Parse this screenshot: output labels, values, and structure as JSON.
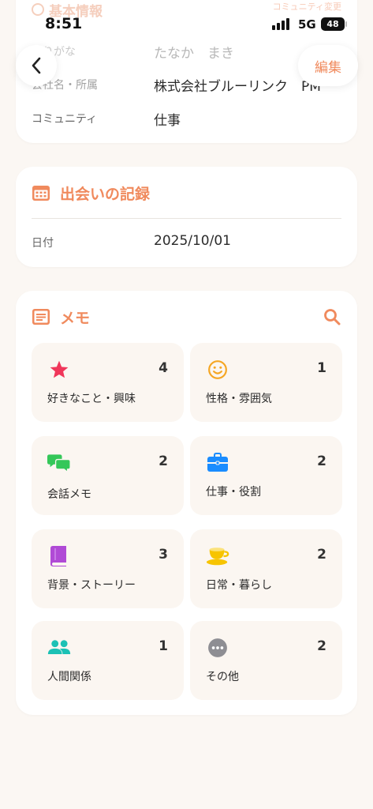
{
  "status_bar": {
    "time": "8:51",
    "network": "5G",
    "battery": "48"
  },
  "nav": {
    "edit_label": "編集"
  },
  "basic_info": {
    "title": "基本情報",
    "change_link": "コミュニティ変更",
    "rows": [
      {
        "label": "ふりがな",
        "value": "たなか　まき"
      },
      {
        "label": "会社名・所属",
        "value": "株式会社ブルーリンク　PM"
      },
      {
        "label": "コミュニティ",
        "value": "仕事"
      }
    ]
  },
  "encounter": {
    "title": "出会いの記録",
    "date_label": "日付",
    "date_value": "2025/10/01"
  },
  "memo": {
    "title": "メモ",
    "categories": [
      {
        "label": "好きなこと・興味",
        "count": "4",
        "icon": "star-icon",
        "color": "#f0365a"
      },
      {
        "label": "性格・雰囲気",
        "count": "1",
        "icon": "smile-icon",
        "color": "#f5a623"
      },
      {
        "label": "会話メモ",
        "count": "2",
        "icon": "chat-bubbles-icon",
        "color": "#34c759"
      },
      {
        "label": "仕事・役割",
        "count": "2",
        "icon": "briefcase-icon",
        "color": "#1a8cff"
      },
      {
        "label": "背景・ストーリー",
        "count": "3",
        "icon": "book-icon",
        "color": "#b04ad6"
      },
      {
        "label": "日常・暮らし",
        "count": "2",
        "icon": "coffee-cup-icon",
        "color": "#f7c400"
      },
      {
        "label": "人間関係",
        "count": "1",
        "icon": "people-icon",
        "color": "#1cc1b5"
      },
      {
        "label": "その他",
        "count": "2",
        "icon": "more-icon",
        "color": "#8e8e93"
      }
    ]
  },
  "colors": {
    "accent": "#f08a5d",
    "background": "#fbf7f3",
    "tile": "#fbf6f1"
  }
}
